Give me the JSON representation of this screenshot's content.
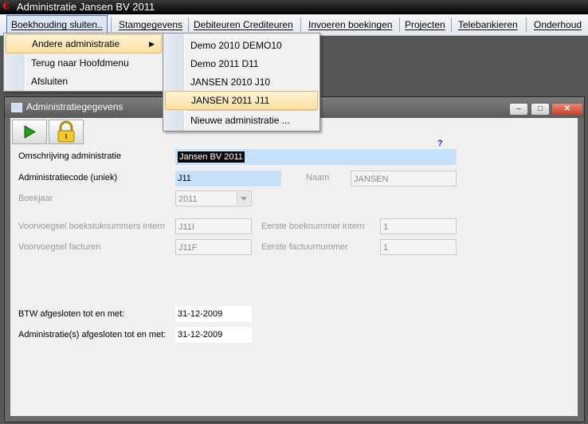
{
  "app": {
    "title": "Administratie Jansen BV 2011"
  },
  "menubar": [
    {
      "label": "Boekhouding sluiten..",
      "active": true
    },
    {
      "label": "Stamgegevens"
    },
    {
      "label": "Debiteuren Crediteuren"
    },
    {
      "label": "Invoeren boekingen"
    },
    {
      "label": "Projecten"
    },
    {
      "label": "Telebankieren"
    },
    {
      "label": "Onderhoud"
    }
  ],
  "main_menu": {
    "items": [
      {
        "label": "Andere administratie",
        "highlighted": true,
        "submenu_arrow": "▶"
      },
      {
        "label": "Terug naar Hoofdmenu"
      },
      {
        "label": "Afsluiten"
      }
    ]
  },
  "sub_menu": {
    "items": [
      {
        "label": "Demo 2010 DEMO10"
      },
      {
        "label": "Demo 2011 D11"
      },
      {
        "label": "JANSEN 2010 J10"
      },
      {
        "label": "JANSEN 2011 J11",
        "highlighted": true
      },
      {
        "label": "Nieuwe administratie ..."
      }
    ]
  },
  "window": {
    "title": "Administratiegegevens",
    "buttons": {
      "minimize": "‒",
      "maximize": "□",
      "close": "✕"
    },
    "help": "?"
  },
  "form": {
    "omschrijving": {
      "label": "Omschrijving administratie",
      "value": "Jansen BV 2011"
    },
    "code": {
      "label": "Administratiecode (uniek)",
      "value": "J11"
    },
    "naam": {
      "label": "Naam",
      "value": "JANSEN"
    },
    "boekjaar": {
      "label": "Boekjaar",
      "value": "2011"
    },
    "vv_boekstuk": {
      "label": "Voorvoegsel boekstuknummers intern",
      "value": "J11I"
    },
    "eerste_boek": {
      "label": "Eerste  boeknummer intern",
      "value": "1"
    },
    "vv_facturen": {
      "label": "Voorvoegsel facturen",
      "value": "J11F"
    },
    "eerste_factuur": {
      "label": "Eerste factuurnummer",
      "value": "1"
    },
    "btw": {
      "label": "BTW afgesloten tot en met:",
      "value": "31-12-2009"
    },
    "adm_afgesloten": {
      "label": "Administratie(s) afgesloten tot en met:",
      "value": "31-12-2009"
    }
  },
  "colors": {
    "menu_highlight": "#ffe0a3",
    "field_blue": "#c7e1fb",
    "title_red": "#e02020",
    "toolbar_green": "#1f9a1f"
  }
}
